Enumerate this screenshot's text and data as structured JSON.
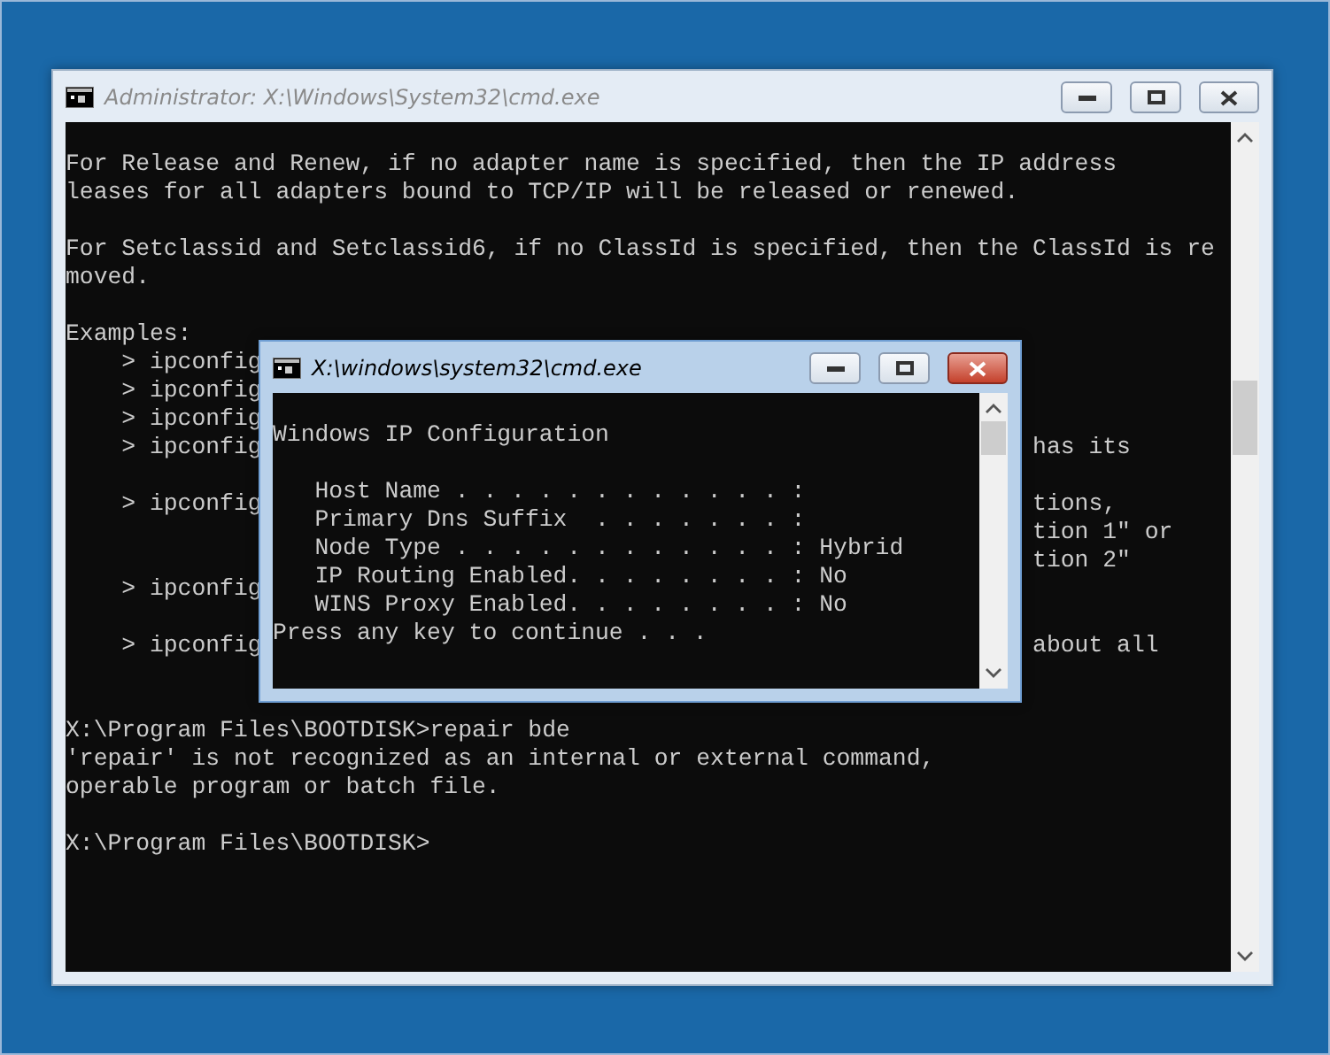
{
  "windows": [
    {
      "title": "Administrator: X:\\Windows\\System32\\cmd.exe",
      "active": false,
      "lines": [
        {
          "kind": "blank"
        },
        {
          "kind": "text",
          "text": "For Release and Renew, if no adapter name is specified, then the IP address"
        },
        {
          "kind": "text",
          "text": "leases for all adapters bound to TCP/IP will be released or renewed."
        },
        {
          "kind": "blank"
        },
        {
          "kind": "text",
          "text": "For Setclassid and Setclassid6, if no ClassId is specified, then the ClassId is re"
        },
        {
          "kind": "text",
          "text": "moved."
        },
        {
          "kind": "blank"
        },
        {
          "kind": "text",
          "text": "Examples:"
        },
        {
          "kind": "example",
          "text": "> ipconfig"
        },
        {
          "kind": "example",
          "text": "> ipconfig"
        },
        {
          "kind": "example",
          "text": "> ipconfig"
        },
        {
          "kind": "example",
          "text": "> ipconfig",
          "right": "has its"
        },
        {
          "kind": "blank"
        },
        {
          "kind": "example",
          "text": "> ipconfig",
          "right": "tions,"
        },
        {
          "kind": "example",
          "right": "tion 1\" or"
        },
        {
          "kind": "example",
          "right": "tion 2\""
        },
        {
          "kind": "example",
          "text": "> ipconfig"
        },
        {
          "kind": "blank"
        },
        {
          "kind": "example",
          "text": "> ipconfig",
          "right": "about all"
        },
        {
          "kind": "blank"
        },
        {
          "kind": "blank"
        },
        {
          "kind": "text",
          "text": "X:\\Program Files\\BOOTDISK>repair bde"
        },
        {
          "kind": "text",
          "text": "'repair' is not recognized as an internal or external command,"
        },
        {
          "kind": "text",
          "text": "operable program or batch file."
        },
        {
          "kind": "blank"
        },
        {
          "kind": "text",
          "text": "X:\\Program Files\\BOOTDISK>"
        }
      ]
    },
    {
      "title": "X:\\windows\\system32\\cmd.exe",
      "active": true,
      "lines": [
        {
          "kind": "blank"
        },
        {
          "kind": "text",
          "text": "Windows IP Configuration"
        },
        {
          "kind": "blank"
        },
        {
          "kind": "field",
          "text": "Host Name . . . . . . . . . . . . :"
        },
        {
          "kind": "field",
          "text": "Primary Dns Suffix  . . . . . . . :"
        },
        {
          "kind": "field",
          "text": "Node Type . . . . . . . . . . . . : Hybrid"
        },
        {
          "kind": "field",
          "text": "IP Routing Enabled. . . . . . . . : No"
        },
        {
          "kind": "field",
          "text": "WINS Proxy Enabled. . . . . . . . : No"
        },
        {
          "kind": "text",
          "text": "Press any key to continue . . ."
        }
      ]
    }
  ]
}
